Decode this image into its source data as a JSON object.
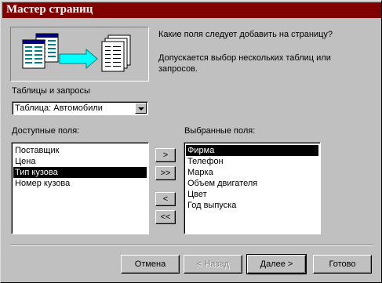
{
  "window": {
    "title": "Мастер страниц"
  },
  "description": {
    "question": "Какие поля следует добавить на страницу?",
    "hint_line1": "Допускается выбор нескольких таблиц или",
    "hint_line2": "запросов."
  },
  "tables_label": "Таблицы и запросы",
  "tables_combo": {
    "selected": "Таблица: Автомобили"
  },
  "available": {
    "label": "Доступные поля:",
    "items": [
      "Поставщик",
      "Цена",
      "Тип кузова",
      "Номер кузова"
    ],
    "selected_index": 2
  },
  "selected": {
    "label": "Выбранные поля:",
    "items": [
      "Фирма",
      "Телефон",
      "Марка",
      "Объем двигателя",
      "Цвет",
      "Год выпуска"
    ],
    "selected_index": 0
  },
  "move_buttons": {
    "add_one": ">",
    "add_all": ">>",
    "remove_one": "<",
    "remove_all": "<<"
  },
  "footer": {
    "cancel": "Отмена",
    "back": "< Назад",
    "next": "Далее >",
    "finish": "Готово"
  },
  "colors": {
    "titlebar": "#800000",
    "face": "#c0c0c0",
    "selection": "#000000"
  }
}
